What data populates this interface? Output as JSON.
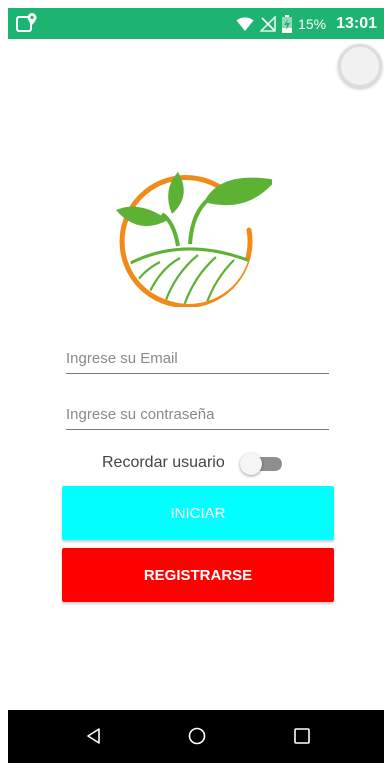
{
  "status_bar": {
    "battery_percent": "15%",
    "time": "13:01",
    "icons": [
      "app-icon",
      "wifi-icon",
      "no-sim-icon",
      "battery-charging-icon"
    ]
  },
  "form": {
    "email_placeholder": "Ingrese su Email",
    "password_placeholder": "Ingrese su contraseña",
    "remember_label": "Recordar usuario",
    "remember_enabled": false
  },
  "buttons": {
    "login_label": "INICIAR",
    "register_label": "REGISTRARSE"
  },
  "nav": {
    "icons": [
      "back-icon",
      "home-icon",
      "recents-icon"
    ]
  },
  "colors": {
    "status_bar": "#1db370",
    "login_button": "#00ffff",
    "register_button": "#ff0000",
    "logo_ring": "#f28a1a",
    "logo_green": "#5db133"
  }
}
